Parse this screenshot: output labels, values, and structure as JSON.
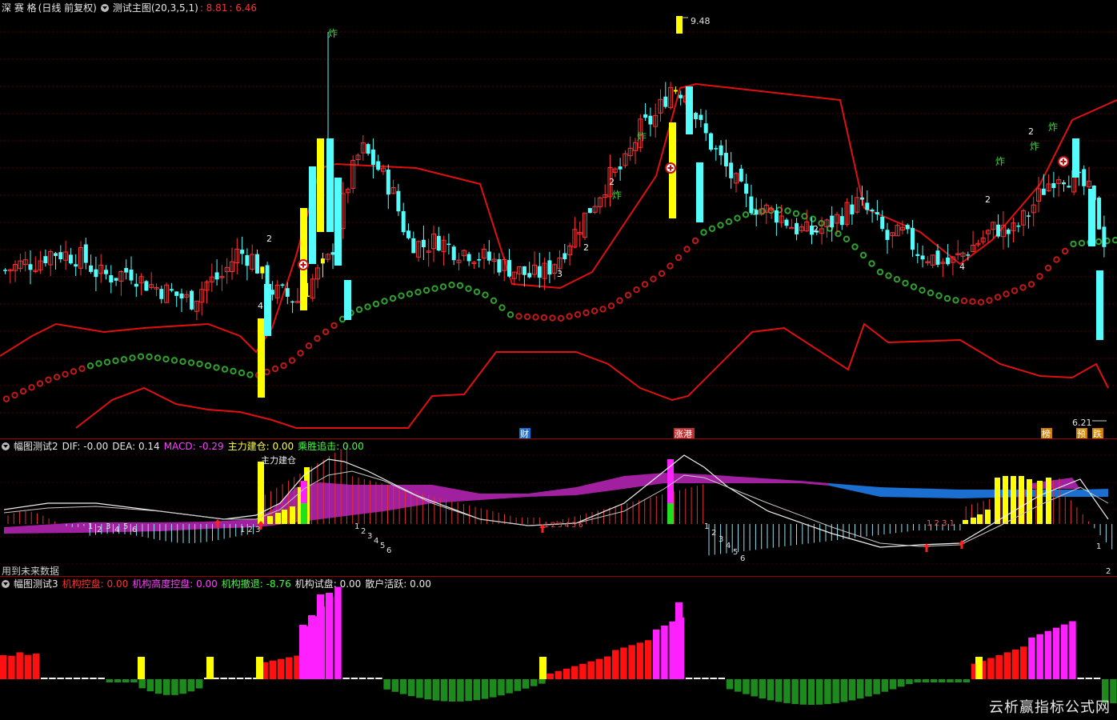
{
  "main_header": {
    "stock": "深 赛 格",
    "period": "(日线 前复权)",
    "indicator": "测试主图(20,3,5,1)",
    "val1": ": 8.81",
    "val2": ": 6.46"
  },
  "main_labels": {
    "high_price": "9.48",
    "low_price": "6.21",
    "events": [
      "财",
      "涨港",
      "榜",
      "预",
      "跌"
    ],
    "boom": "炸",
    "jump_marks": [
      "4",
      "2",
      "3",
      "2",
      "2",
      "2",
      "4",
      "2"
    ]
  },
  "macd_header": {
    "title": "幅图测试2",
    "dif": "DIF: -0.00",
    "dea": "DEA: 0.14",
    "macd": "MACD: -0.29",
    "main_build": "主力建仓: 0.00",
    "chase": "乘胜追击: 0.00",
    "annotation": "主力建仓",
    "future_note": "用到未来数据"
  },
  "inst_header": {
    "title": "幅图测试3",
    "control": "机构控盘: 0.00",
    "high_control": "机构高度控盘: 0.00",
    "retreat": "机构撤退: -8.76",
    "trial": "机构试盘: 0.00",
    "retail": "散户活跃: 0.00"
  },
  "watermark": "云析赢指标公式网",
  "colors": {
    "up": "#ff3232",
    "down": "#54fcfc",
    "yellow": "#ffff00",
    "red_line": "#e01010",
    "green_dot": "#2ea02e",
    "purple": "#a020a0",
    "blue": "#1a6fd0",
    "magenta": "#ff20ff",
    "dark_green": "#1c8a1c"
  },
  "chart_data": [
    {
      "type": "candlestick",
      "title": "测试主图(20,3,5,1)",
      "y_markers": {
        "high": 9.48,
        "low": 6.21
      },
      "close_path": [
        7.45,
        7.5,
        7.52,
        7.6,
        7.58,
        7.55,
        7.42,
        7.4,
        7.45,
        7.35,
        7.3,
        7.25,
        7.2,
        7.35,
        7.4,
        7.6,
        7.55,
        7.3,
        7.25,
        7.2,
        7.4,
        7.55,
        8.1,
        8.45,
        8.3,
        8.1,
        7.7,
        7.65,
        7.7,
        7.62,
        7.6,
        7.55,
        7.5,
        7.45,
        7.4,
        7.45,
        7.6,
        7.8,
        8.0,
        8.2,
        8.3,
        8.6,
        8.7,
        8.95,
        8.9,
        8.6,
        8.4,
        8.2,
        8.0,
        7.95,
        7.9,
        7.8,
        7.75,
        7.8,
        7.9,
        8.0,
        7.9,
        7.7,
        7.75,
        7.6,
        7.55,
        7.5,
        7.6,
        7.7,
        7.8,
        7.75,
        7.9,
        8.1,
        8.25,
        8.2,
        8.1,
        7.7
      ]
    },
    {
      "type": "macd",
      "series": [
        {
          "name": "DIF",
          "value": -0.0
        },
        {
          "name": "DEA",
          "value": 0.14
        },
        {
          "name": "MACD",
          "value": -0.29
        }
      ]
    },
    {
      "type": "bar",
      "series": [
        {
          "name": "机构控盘",
          "value": 0.0
        },
        {
          "name": "机构高度控盘",
          "value": 0.0
        },
        {
          "name": "机构撤退",
          "value": -8.76
        },
        {
          "name": "机构试盘",
          "value": 0.0
        },
        {
          "name": "散户活跃",
          "value": 0.0
        }
      ]
    }
  ]
}
